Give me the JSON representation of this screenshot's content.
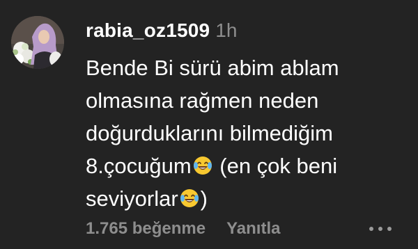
{
  "comment": {
    "username": "rabia_oz1509",
    "time": "1h",
    "lines": [
      "Bende Bi sürü abim ablam",
      "olmasına rağmen neden",
      "doğurduklarını bilmediğim",
      "8.çocuğum",
      " (en çok beni",
      "seviyorlar",
      ")"
    ],
    "emoji": "face-with-tears-of-joy-icon"
  },
  "footer": {
    "likes": "1.765 beğenme",
    "reply": "Yanıtla"
  },
  "colors": {
    "background": "#232323",
    "text": "#ffffff",
    "muted": "#8e8e8e"
  }
}
